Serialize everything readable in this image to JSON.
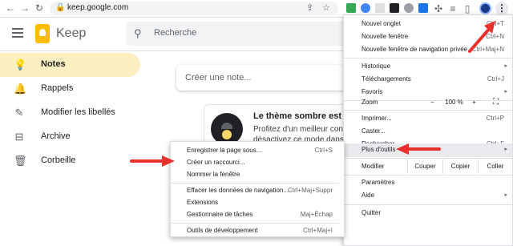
{
  "browser": {
    "url": "keep.google.com",
    "icons": [
      "back-arrow-icon",
      "forward-arrow-icon",
      "reload-icon",
      "lock-icon",
      "share-icon",
      "star-icon"
    ],
    "accent": "#8ab4f8"
  },
  "keep": {
    "app_name": "Keep",
    "search_placeholder": "Recherche",
    "note_placeholder": "Créer une note...",
    "brand_color": "#fbbc04"
  },
  "sidebar": {
    "items": [
      {
        "label": "Notes",
        "active": true
      },
      {
        "label": "Rappels"
      },
      {
        "label": "Modifier les libellés"
      },
      {
        "label": "Archive"
      },
      {
        "label": "Corbeille"
      }
    ]
  },
  "promo": {
    "title": "Le thème sombre est di",
    "line1": "Profitez d'un meilleur confor",
    "line2": "désactivez ce mode dans le"
  },
  "menu": {
    "new_tab": {
      "label": "Nouvel onglet",
      "shortcut": "Ctrl+T"
    },
    "new_window": {
      "label": "Nouvelle fenêtre",
      "shortcut": "Ctrl+N"
    },
    "new_private": {
      "label": "Nouvelle fenêtre de navigation privée",
      "shortcut": "Ctrl+Maj+N"
    },
    "history": {
      "label": "Historique"
    },
    "downloads": {
      "label": "Téléchargements",
      "shortcut": "Ctrl+J"
    },
    "bookmarks": {
      "label": "Favoris"
    },
    "zoom": {
      "label": "Zoom",
      "minus": "−",
      "value": "100 %",
      "plus": "+"
    },
    "print": {
      "label": "Imprimer...",
      "shortcut": "Ctrl+P"
    },
    "cast": {
      "label": "Caster..."
    },
    "find": {
      "label": "Rechercher...",
      "shortcut": "Ctrl+F"
    },
    "more_tools": {
      "label": "Plus d'outils"
    },
    "edit": {
      "label": "Modifier",
      "cut": "Couper",
      "copy": "Copier",
      "paste": "Coller"
    },
    "settings": {
      "label": "Paramètres"
    },
    "help": {
      "label": "Aide"
    },
    "quit": {
      "label": "Quitter"
    }
  },
  "submenu": {
    "save_page": {
      "label": "Enregistrer la page sous...",
      "shortcut": "Ctrl+S"
    },
    "create_shortcut": {
      "label": "Créer un raccourci..."
    },
    "name_window": {
      "label": "Nommer la fenêtre"
    },
    "clear_data": {
      "label": "Effacer les données de navigation...",
      "shortcut": "Ctrl+Maj+Suppr"
    },
    "extensions": {
      "label": "Extensions"
    },
    "task_manager": {
      "label": "Gestionnaire de tâches",
      "shortcut": "Maj+Échap"
    },
    "dev_tools": {
      "label": "Outils de développement",
      "shortcut": "Ctrl+Maj+I"
    }
  },
  "annotation_color": "#e8302c"
}
